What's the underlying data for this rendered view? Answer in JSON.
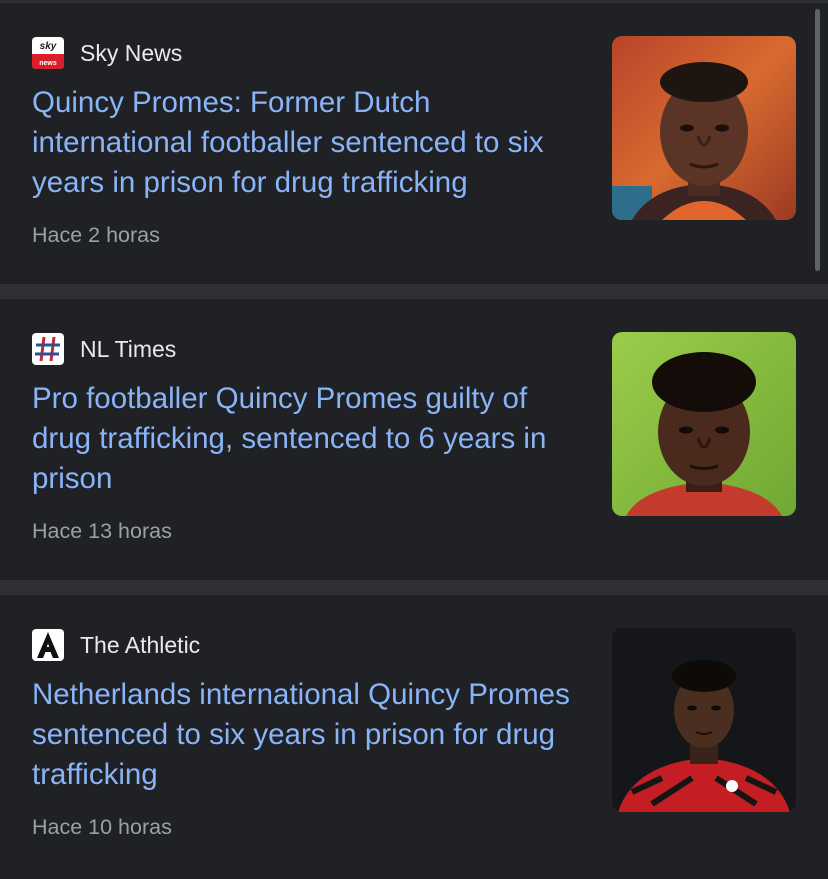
{
  "articles": [
    {
      "source": "Sky News",
      "source_icon": "sky-news-logo-icon",
      "title": "Quincy Promes: Former Dutch international footballer sentenced to six years in prison for drug trafficking",
      "time": "Hace 2 horas",
      "thumbnail": "player-portrait-orange-background"
    },
    {
      "source": "NL Times",
      "source_icon": "nl-times-hash-logo-icon",
      "title": "Pro footballer Quincy Promes guilty of drug trafficking, sentenced to 6 years in prison",
      "time": "Hace 13 horas",
      "thumbnail": "player-portrait-green-pitch-background"
    },
    {
      "source": "The Athletic",
      "source_icon": "the-athletic-a-logo-icon",
      "title": "Netherlands international Quincy Promes sentenced to six years in prison for drug trafficking",
      "time": "Hace 10 horas",
      "thumbnail": "player-portrait-dark-background-red-kit"
    }
  ],
  "colors": {
    "page_background": "#303134",
    "card_background": "#202124",
    "headline_link": "#8ab4f8",
    "source_text": "#e8eaed",
    "time_text": "#9aa0a6"
  }
}
